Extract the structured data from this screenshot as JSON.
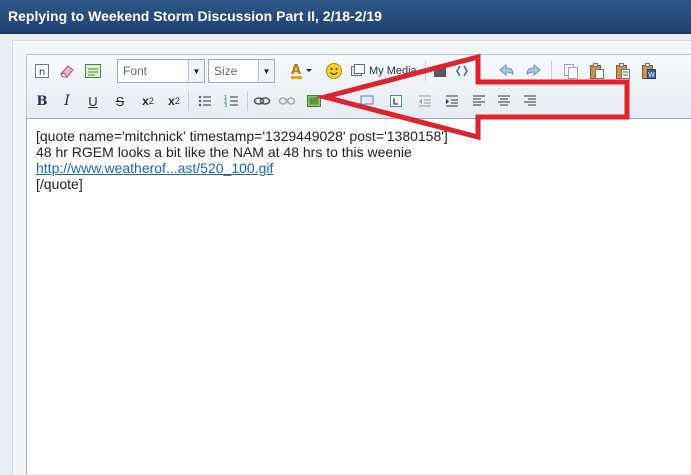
{
  "header": {
    "title": "Replying to Weekend Storm Discussion Part II, 2/18-2/19"
  },
  "toolbar": {
    "font_label": "Font",
    "size_label": "Size",
    "media_label": "My Media",
    "bold": "B",
    "italic": "I",
    "underline": "U",
    "strike": "S",
    "subscript": "x",
    "superscript": "x",
    "sub_mark": "2",
    "sup_mark": "2"
  },
  "editor": {
    "lines": [
      "[quote name='mitchnick' timestamp='1329449028' post='1380158']",
      "48 hr RGEM looks a bit like the NAM at 48 hrs to this weenie",
      "http://www.weatherof...ast/520_100.gif",
      "[/quote]"
    ]
  },
  "annotation": {
    "arrow_color": "#e0222b",
    "points_to": "insert-image-icon"
  }
}
